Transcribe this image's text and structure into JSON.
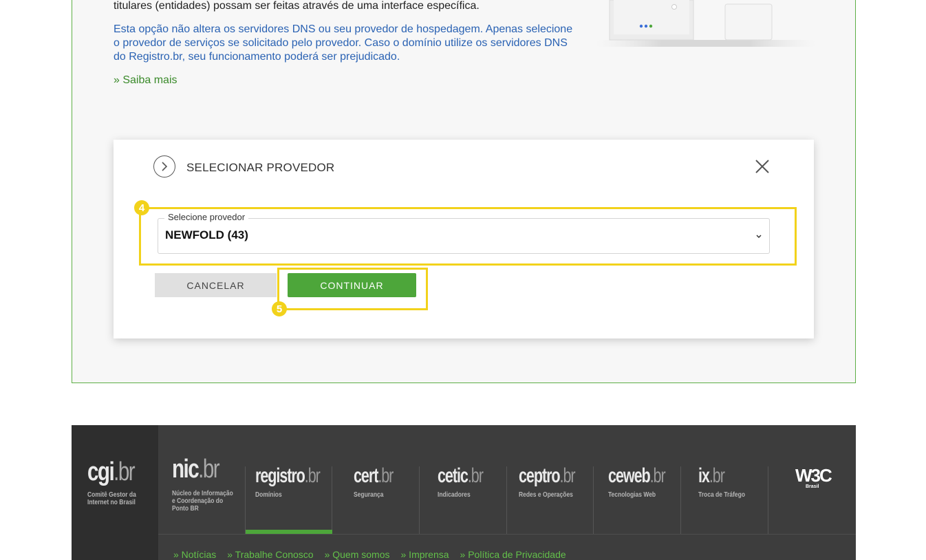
{
  "intro": {
    "line_top": "titulares (entidades) possam ser feitas através de uma interface específica.",
    "blue_text": "Esta opção não altera os servidores DNS ou seu provedor de hospedagem. Apenas selecione o provedor de serviços se solicitado pelo provedor. Caso o domínio utilize os servidores DNS do Registro.br, seu funcionamento poderá ser prejudicado.",
    "saiba_mais": "» Saiba mais"
  },
  "modal": {
    "title": "SELECIONAR PROVEDOR",
    "select_label": "Selecione provedor",
    "select_value": "NEWFOLD (43)",
    "cancel_label": "CANCELAR",
    "continue_label": "CONTINUAR"
  },
  "annotations": {
    "step_select": "4",
    "step_continue": "5",
    "highlight_color": "#f2d21b"
  },
  "footer": {
    "cgi": {
      "name_a": "cgi",
      "name_b": ".br",
      "sub1": "Comitê Gestor da",
      "sub2": "Internet no Brasil"
    },
    "nic": {
      "name_a": "nic",
      "name_b": ".br",
      "sub1": "Núcleo de Informação",
      "sub2": "e Coordenação do",
      "sub3": "Ponto BR"
    },
    "sites": [
      {
        "name_a": "registro",
        "name_b": ".br",
        "sub": "Domínios"
      },
      {
        "name_a": "cert",
        "name_b": ".br",
        "sub": "Segurança"
      },
      {
        "name_a": "cetic",
        "name_b": ".br",
        "sub": "Indicadores"
      },
      {
        "name_a": "ceptro",
        "name_b": ".br",
        "sub": "Redes e Operações"
      },
      {
        "name_a": "ceweb",
        "name_b": ".br",
        "sub": "Tecnologias Web"
      },
      {
        "name_a": "ix",
        "name_b": ".br",
        "sub": "Troca de Tráfego"
      }
    ],
    "w3c": "W3C",
    "w3c_sub": "Brasil",
    "links": [
      "» Notícias",
      "» Trabalhe Conosco",
      "» Quem somos",
      "» Imprensa",
      "» Política de Privacidade"
    ]
  },
  "colors": {
    "accent_green": "#4da63a",
    "link_blue": "#2a62b3",
    "footer_bg": "#3d3d3d"
  }
}
